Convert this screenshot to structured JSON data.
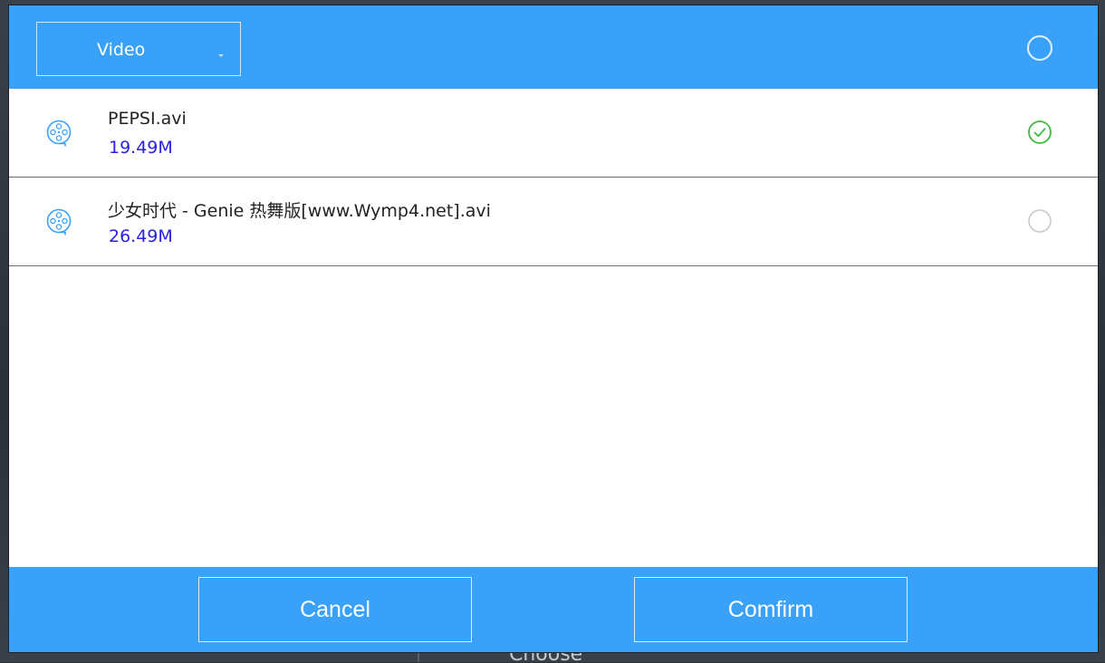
{
  "header": {
    "filter_label": "Video",
    "select_all_checked": false
  },
  "files": [
    {
      "name": "PEPSI.avi",
      "size": "19.49M",
      "selected": true,
      "icon": "film-reel-icon"
    },
    {
      "name": "少女时代 - Genie 热舞版[www.Wymp4.net].avi",
      "size": "26.49M",
      "selected": false,
      "icon": "film-reel-icon"
    }
  ],
  "footer": {
    "cancel_label": "Cancel",
    "confirm_label": "Comfirm"
  },
  "background": {
    "hint_text": "Choose"
  },
  "colors": {
    "bar": "#3aa1f9",
    "size_text": "#2a20e6",
    "check_green": "#3dbb3d",
    "icon_blue": "#3aa1f9"
  }
}
